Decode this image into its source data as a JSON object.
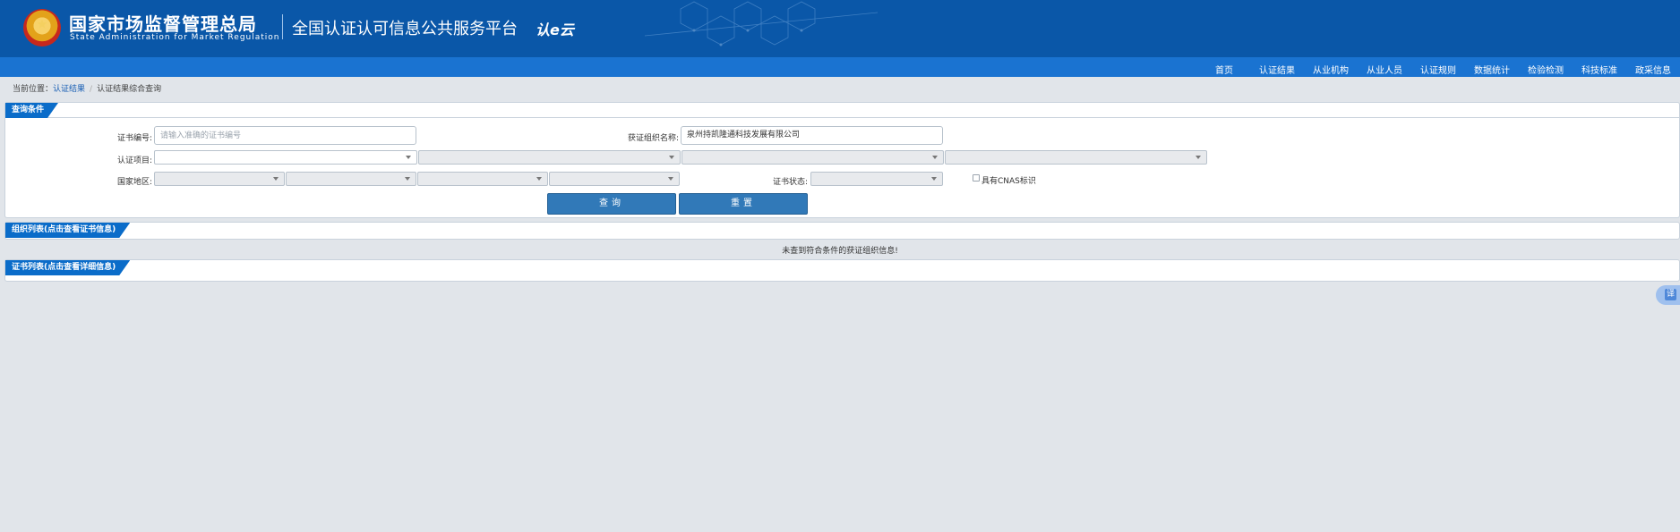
{
  "header": {
    "org_cn": "国家市场监督管理总局",
    "org_en": "State Administration  for  Market Regulation",
    "platform": "全国认证认可信息公共服务平台",
    "brand": "认e云"
  },
  "nav": {
    "items": [
      "首页",
      "认证结果",
      "从业机构",
      "从业人员",
      "认证规则",
      "数据统计",
      "检验检测",
      "科技标准",
      "政采信息"
    ]
  },
  "breadcrumb": {
    "prefix": "当前位置：",
    "link": "认证结果",
    "sep": "/",
    "current": "认证结果综合查询"
  },
  "query": {
    "tab": "查询条件",
    "cert_no_label": "证书编号:",
    "cert_no_placeholder": "请输入准确的证书编号",
    "org_name_label": "获证组织名称:",
    "org_name_value": "泉州持凯隆通科技发展有限公司",
    "project_label": "认证项目:",
    "region_label": "国家地区:",
    "status_label": "证书状态:",
    "cnas_label": "具有CNAS标识",
    "search_button": "查询",
    "reset_button": "重置"
  },
  "org_list": {
    "tab": "组织列表(点击查看证书信息)",
    "empty_message": "未查到符合条件的获证组织信息!"
  },
  "cert_list": {
    "tab": "证书列表(点击查看详细信息)"
  },
  "side_button": {
    "glyph": "译"
  }
}
